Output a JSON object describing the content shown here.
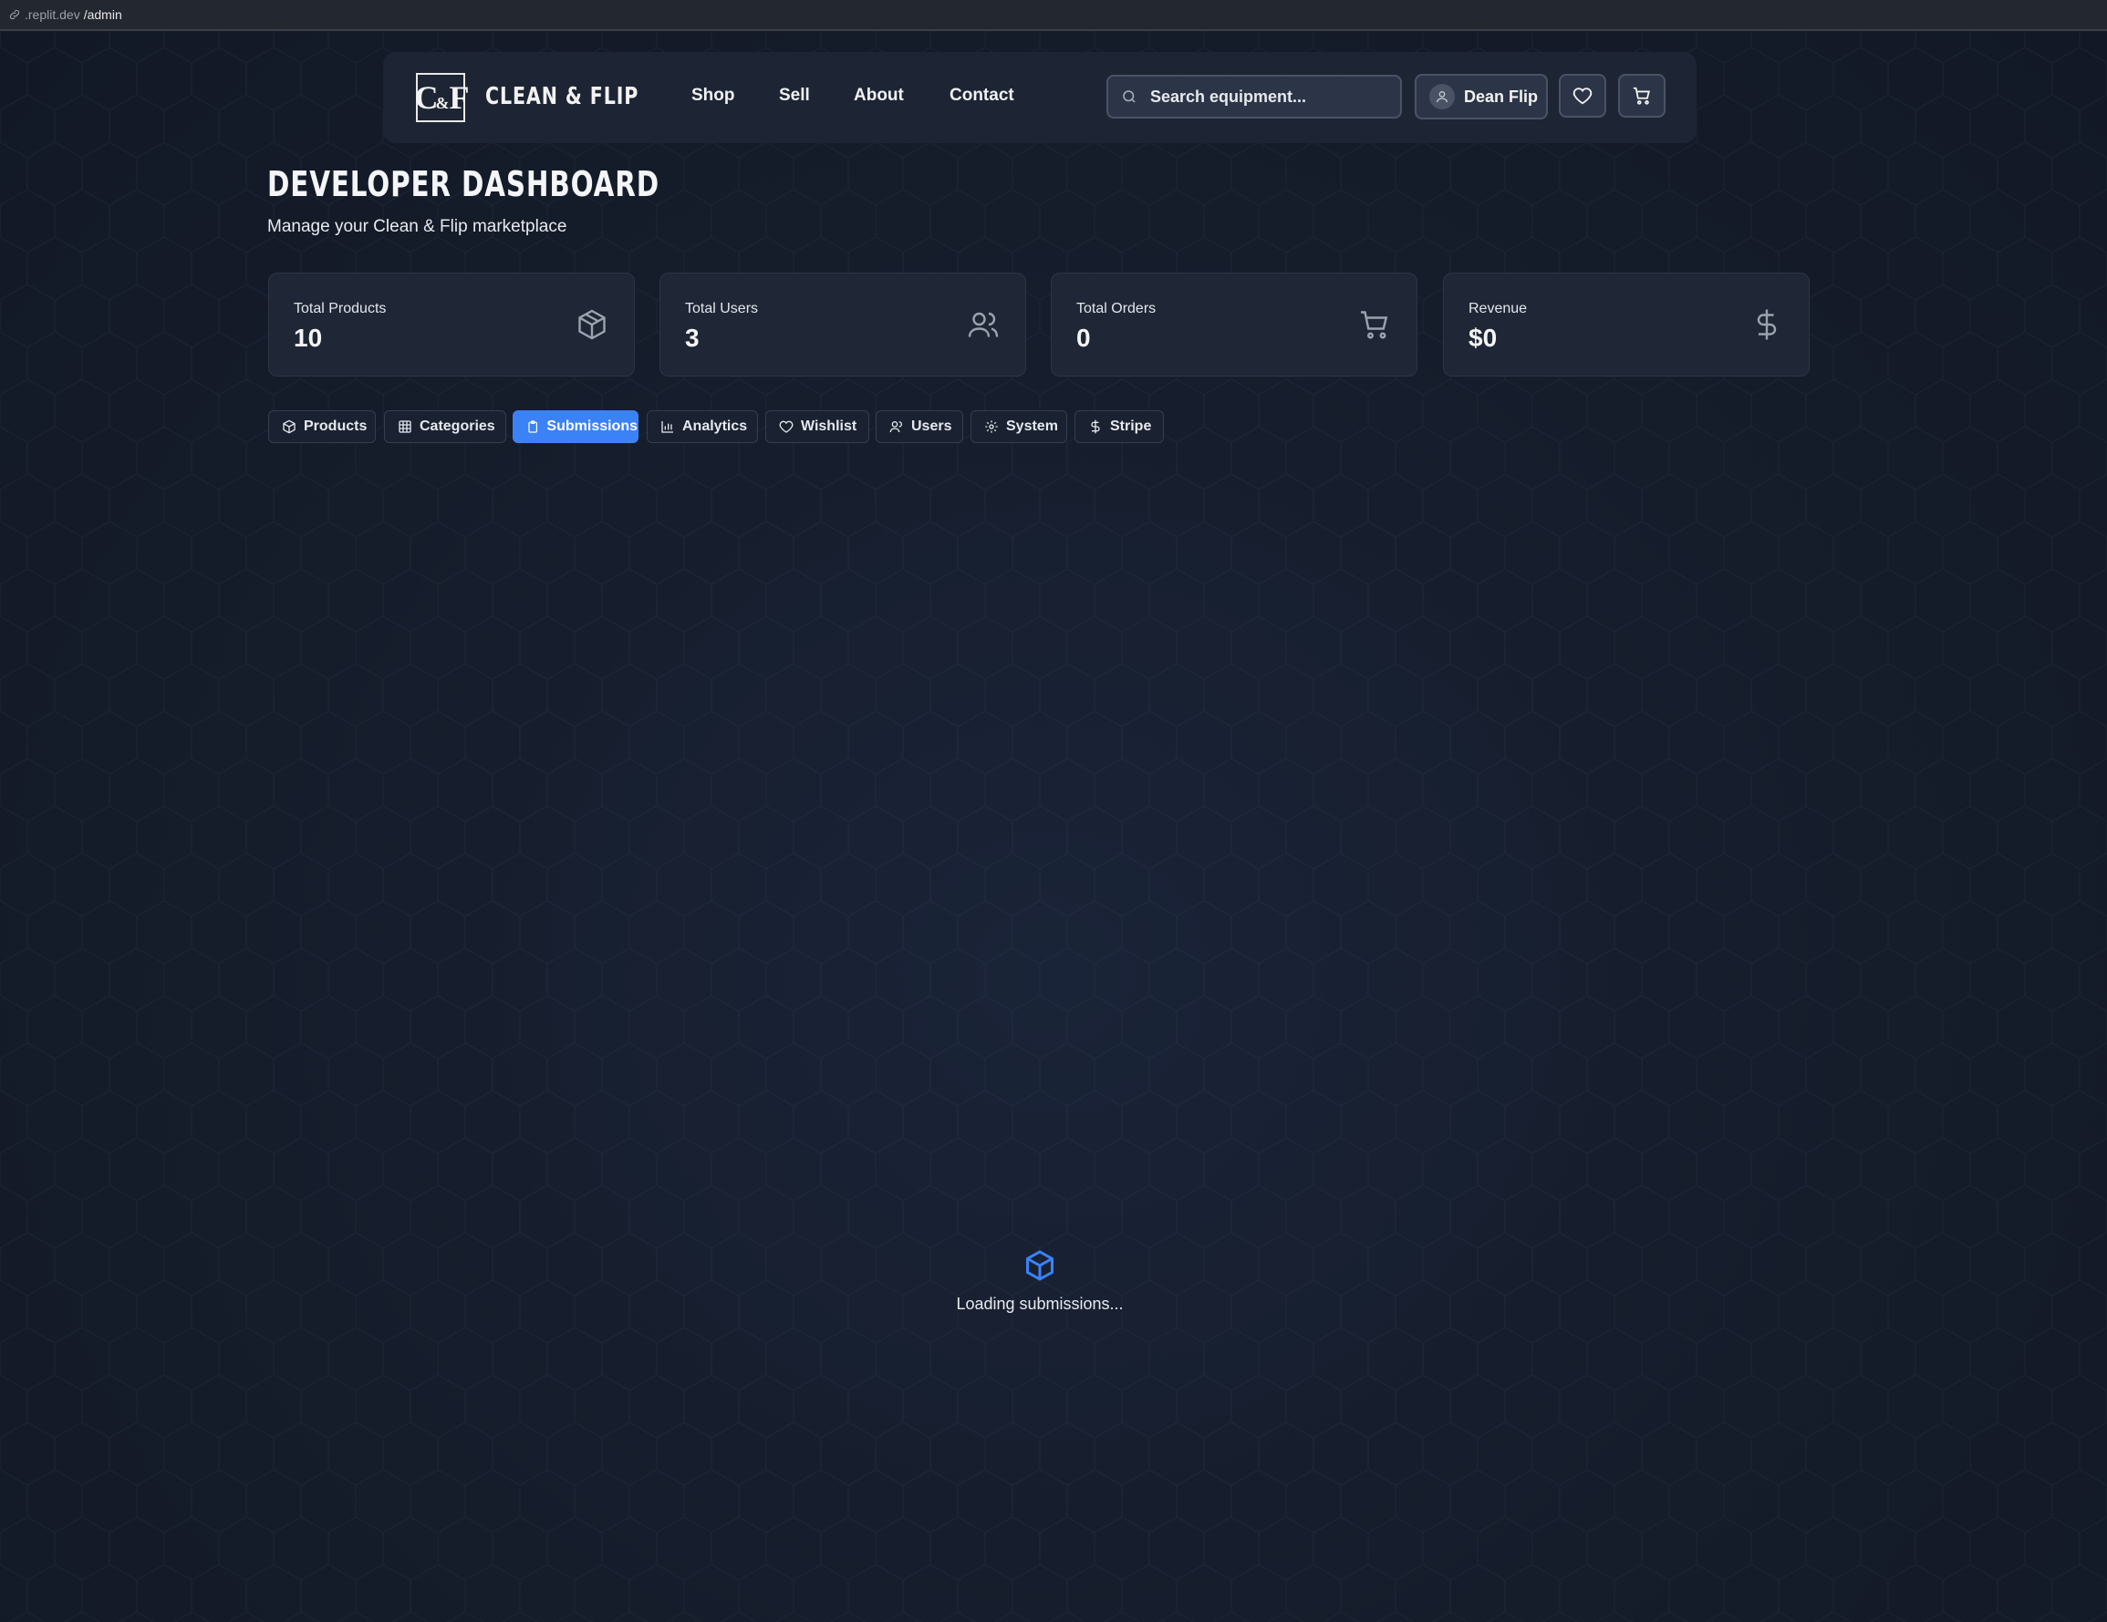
{
  "url": {
    "domain": ".replit.dev",
    "path": "/admin"
  },
  "brand": {
    "logo_text": "C&F",
    "name": "CLEAN & FLIP"
  },
  "nav": {
    "links": [
      "Shop",
      "Sell",
      "About",
      "Contact"
    ]
  },
  "search": {
    "placeholder": "Search equipment..."
  },
  "user": {
    "name": "Dean Flip"
  },
  "page": {
    "title": "DEVELOPER DASHBOARD",
    "subtitle": "Manage your Clean & Flip marketplace"
  },
  "stats": [
    {
      "label": "Total Products",
      "value": "10",
      "icon": "package-icon"
    },
    {
      "label": "Total Users",
      "value": "3",
      "icon": "users-icon"
    },
    {
      "label": "Total Orders",
      "value": "0",
      "icon": "cart-icon"
    },
    {
      "label": "Revenue",
      "value": "$0",
      "icon": "dollar-icon"
    }
  ],
  "tabs": [
    {
      "label": "Products",
      "icon": "package-icon"
    },
    {
      "label": "Categories",
      "icon": "grid-icon"
    },
    {
      "label": "Submissions",
      "icon": "clipboard-icon",
      "active": true
    },
    {
      "label": "Analytics",
      "icon": "bar-chart-icon"
    },
    {
      "label": "Wishlist",
      "icon": "heart-icon"
    },
    {
      "label": "Users",
      "icon": "users-icon"
    },
    {
      "label": "System",
      "icon": "gear-icon"
    },
    {
      "label": "Stripe",
      "icon": "dollar-icon"
    }
  ],
  "loading": {
    "message": "Loading submissions..."
  },
  "colors": {
    "accent": "#3b82f6",
    "background": "#151c2a",
    "card": "#1f2736"
  }
}
